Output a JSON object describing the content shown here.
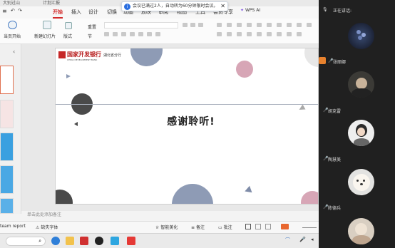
{
  "titlebar": {
    "tabs": [
      "大别过山",
      "计划汇报"
    ]
  },
  "ribbon_tabs": [
    "开始",
    "插入",
    "设计",
    "切换",
    "动画",
    "放映",
    "审阅",
    "视图",
    "工具",
    "会员专享"
  ],
  "active_tab": "开始",
  "notice": {
    "text": "会议已满过2人，自动转为60分钟限时会议。",
    "close": "✕"
  },
  "wps_ai": "WPS AI",
  "ribbon": {
    "from_start": "当页开始",
    "new_slide": "新建幻灯片",
    "layout": "版式",
    "reset": "重置",
    "section": "节"
  },
  "slide": {
    "logo_cn": "国家开发银行",
    "logo_en": "CHINA DEVELOPMENT BANK",
    "branch": "湖北省分行",
    "title": "感谢聆听!"
  },
  "notes_placeholder": "单击此处添加备注",
  "status": {
    "left": "team report",
    "missing_font": "缺失字体",
    "beautify": "智能美化",
    "notes": "备注",
    "comments": "批注"
  },
  "right_panel": {
    "speaking": "正在讲话:",
    "participants": [
      {
        "name": "张丽娜"
      },
      {
        "name": "胡克雷"
      },
      {
        "name": "陶慧美"
      },
      {
        "name": "陈德兵"
      }
    ]
  },
  "colors": {
    "accent": "#d22b2b",
    "slide_navy": "#8e9bb5",
    "slide_pink": "#d7a6b6",
    "slide_dark": "#4a4a4a"
  }
}
